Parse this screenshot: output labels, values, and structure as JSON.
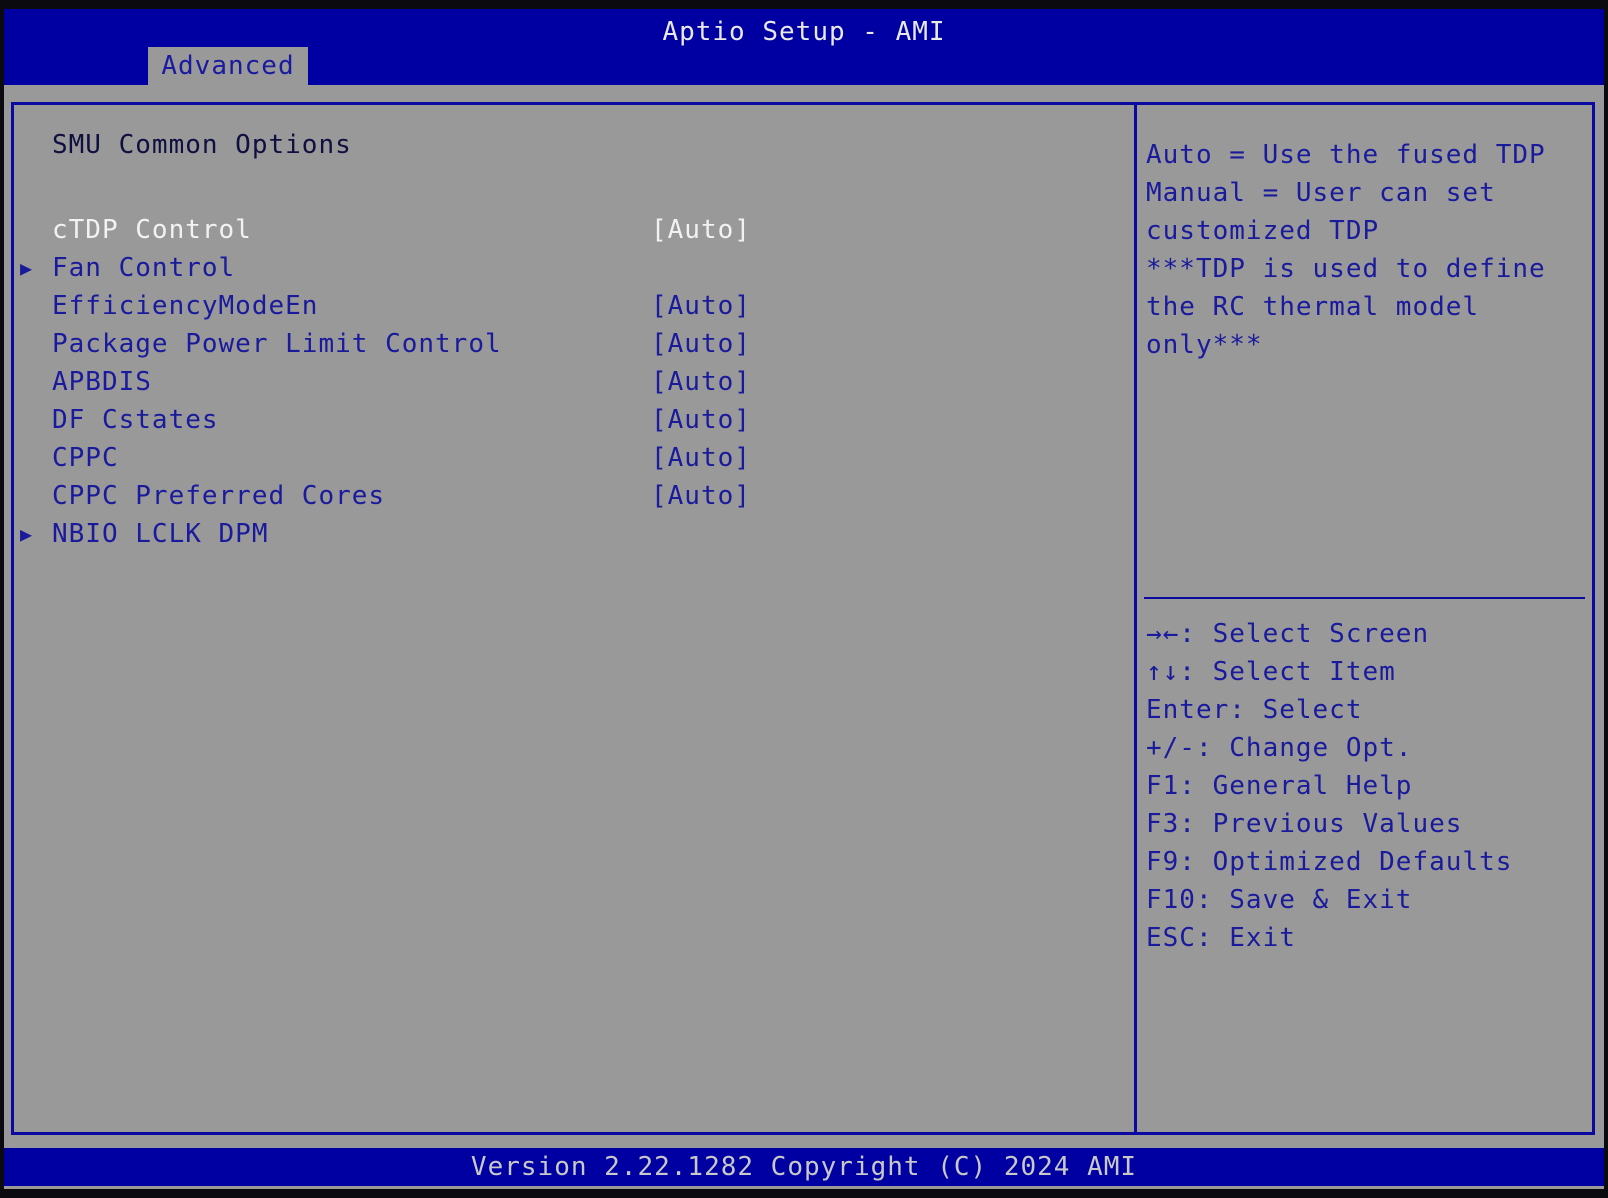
{
  "header": {
    "title": "Aptio Setup - AMI",
    "tabs": [
      {
        "label": "Advanced",
        "active": true
      }
    ]
  },
  "main": {
    "section_title": "SMU Common Options",
    "items": [
      {
        "label": "cTDP Control",
        "value": "[Auto]",
        "submenu": false,
        "selected": true
      },
      {
        "label": "Fan Control",
        "value": "",
        "submenu": true,
        "selected": false
      },
      {
        "label": "EfficiencyModeEn",
        "value": "[Auto]",
        "submenu": false,
        "selected": false
      },
      {
        "label": "Package Power Limit Control",
        "value": "[Auto]",
        "submenu": false,
        "selected": false
      },
      {
        "label": "APBDIS",
        "value": "[Auto]",
        "submenu": false,
        "selected": false
      },
      {
        "label": "DF Cstates",
        "value": "[Auto]",
        "submenu": false,
        "selected": false
      },
      {
        "label": "CPPC",
        "value": "[Auto]",
        "submenu": false,
        "selected": false
      },
      {
        "label": "CPPC Preferred Cores",
        "value": "[Auto]",
        "submenu": false,
        "selected": false
      },
      {
        "label": "NBIO LCLK DPM",
        "value": "",
        "submenu": true,
        "selected": false
      }
    ],
    "submenu_icon": "▶"
  },
  "help": {
    "description": [
      "Auto = Use the fused TDP",
      "Manual = User can set",
      "customized TDP",
      "***TDP is used to define",
      "the RC thermal model",
      "only***"
    ],
    "keys": [
      "→←: Select Screen",
      "↑↓: Select Item",
      "Enter: Select",
      "+/-: Change Opt.",
      "F1: General Help",
      "F3: Previous Values",
      "F9: Optimized Defaults",
      "F10: Save & Exit",
      "ESC: Exit"
    ]
  },
  "footer": {
    "text": "Version 2.22.1282 Copyright (C) 2024 AMI"
  },
  "colors": {
    "header_blue": "#0000a2",
    "panel_gray": "#999999",
    "text_blue": "#1a1a9c",
    "selected_text": "#f2f2f2"
  }
}
